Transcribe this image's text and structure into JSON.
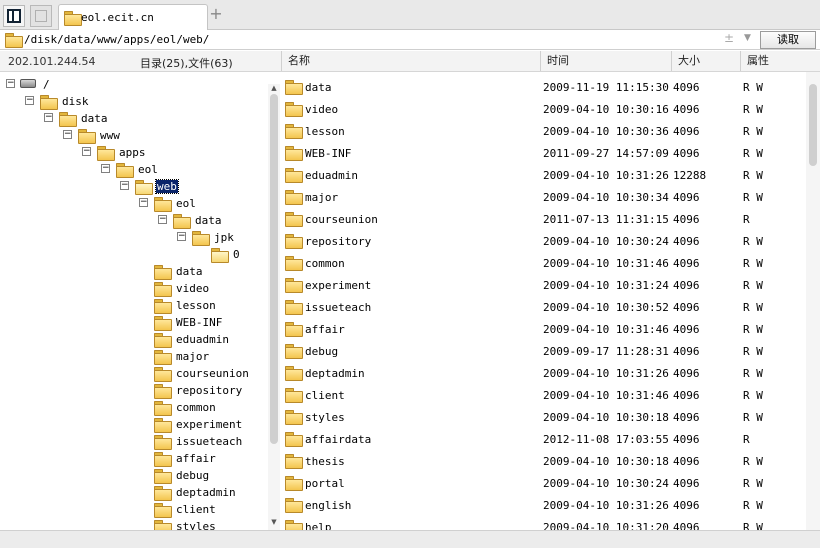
{
  "tabbar": {
    "active_tab_label": "eol.ecit.cn",
    "add_tab_glyph": "+"
  },
  "pathbar": {
    "path": "/disk/data/www/apps/eol/web/",
    "plus_minus_glyph": "±",
    "read_button_label": "读取"
  },
  "status": {
    "ip": "202.101.244.54",
    "counts": "目录(25),文件(63)"
  },
  "columns": {
    "name": "名称",
    "time": "时间",
    "size": "大小",
    "attr": "属性"
  },
  "tree": [
    {
      "label": "/",
      "depth": 0,
      "kind": "drive",
      "expander": "−"
    },
    {
      "label": "disk",
      "depth": 1,
      "kind": "folder",
      "expander": "−"
    },
    {
      "label": "data",
      "depth": 2,
      "kind": "folder",
      "expander": "−"
    },
    {
      "label": "www",
      "depth": 3,
      "kind": "folder",
      "expander": "−"
    },
    {
      "label": "apps",
      "depth": 4,
      "kind": "folder",
      "expander": "−"
    },
    {
      "label": "eol",
      "depth": 5,
      "kind": "folder",
      "expander": "−"
    },
    {
      "label": "web",
      "depth": 6,
      "kind": "open",
      "expander": "−",
      "selected": true
    },
    {
      "label": "eol",
      "depth": 7,
      "kind": "folder",
      "expander": "−"
    },
    {
      "label": "data",
      "depth": 8,
      "kind": "folder",
      "expander": "−"
    },
    {
      "label": "jpk",
      "depth": 9,
      "kind": "folder",
      "expander": "−"
    },
    {
      "label": "0",
      "depth": 10,
      "kind": "open",
      "expander": ""
    },
    {
      "label": "data",
      "depth": 7,
      "kind": "folder",
      "expander": ""
    },
    {
      "label": "video",
      "depth": 7,
      "kind": "folder",
      "expander": ""
    },
    {
      "label": "lesson",
      "depth": 7,
      "kind": "folder",
      "expander": ""
    },
    {
      "label": "WEB-INF",
      "depth": 7,
      "kind": "folder",
      "expander": ""
    },
    {
      "label": "eduadmin",
      "depth": 7,
      "kind": "folder",
      "expander": ""
    },
    {
      "label": "major",
      "depth": 7,
      "kind": "folder",
      "expander": ""
    },
    {
      "label": "courseunion",
      "depth": 7,
      "kind": "folder",
      "expander": ""
    },
    {
      "label": "repository",
      "depth": 7,
      "kind": "folder",
      "expander": ""
    },
    {
      "label": "common",
      "depth": 7,
      "kind": "folder",
      "expander": ""
    },
    {
      "label": "experiment",
      "depth": 7,
      "kind": "folder",
      "expander": ""
    },
    {
      "label": "issueteach",
      "depth": 7,
      "kind": "folder",
      "expander": ""
    },
    {
      "label": "affair",
      "depth": 7,
      "kind": "folder",
      "expander": ""
    },
    {
      "label": "debug",
      "depth": 7,
      "kind": "folder",
      "expander": ""
    },
    {
      "label": "deptadmin",
      "depth": 7,
      "kind": "folder",
      "expander": ""
    },
    {
      "label": "client",
      "depth": 7,
      "kind": "folder",
      "expander": ""
    },
    {
      "label": "styles",
      "depth": 7,
      "kind": "folder",
      "expander": ""
    }
  ],
  "files": [
    {
      "name": "data",
      "time": "2009-11-19 11:15:30",
      "size": "4096",
      "attr": "R W"
    },
    {
      "name": "video",
      "time": "2009-04-10 10:30:16",
      "size": "4096",
      "attr": "R W"
    },
    {
      "name": "lesson",
      "time": "2009-04-10 10:30:36",
      "size": "4096",
      "attr": "R W"
    },
    {
      "name": "WEB-INF",
      "time": "2011-09-27 14:57:09",
      "size": "4096",
      "attr": "R W"
    },
    {
      "name": "eduadmin",
      "time": "2009-04-10 10:31:26",
      "size": "12288",
      "attr": "R W"
    },
    {
      "name": "major",
      "time": "2009-04-10 10:30:34",
      "size": "4096",
      "attr": "R W"
    },
    {
      "name": "courseunion",
      "time": "2011-07-13 11:31:15",
      "size": "4096",
      "attr": "R"
    },
    {
      "name": "repository",
      "time": "2009-04-10 10:30:24",
      "size": "4096",
      "attr": "R W"
    },
    {
      "name": "common",
      "time": "2009-04-10 10:31:46",
      "size": "4096",
      "attr": "R W"
    },
    {
      "name": "experiment",
      "time": "2009-04-10 10:31:24",
      "size": "4096",
      "attr": "R W"
    },
    {
      "name": "issueteach",
      "time": "2009-04-10 10:30:52",
      "size": "4096",
      "attr": "R W"
    },
    {
      "name": "affair",
      "time": "2009-04-10 10:31:46",
      "size": "4096",
      "attr": "R W"
    },
    {
      "name": "debug",
      "time": "2009-09-17 11:28:31",
      "size": "4096",
      "attr": "R W"
    },
    {
      "name": "deptadmin",
      "time": "2009-04-10 10:31:26",
      "size": "4096",
      "attr": "R W"
    },
    {
      "name": "client",
      "time": "2009-04-10 10:31:46",
      "size": "4096",
      "attr": "R W"
    },
    {
      "name": "styles",
      "time": "2009-04-10 10:30:18",
      "size": "4096",
      "attr": "R W"
    },
    {
      "name": "affairdata",
      "time": "2012-11-08 17:03:55",
      "size": "4096",
      "attr": "R"
    },
    {
      "name": "thesis",
      "time": "2009-04-10 10:30:18",
      "size": "4096",
      "attr": "R W"
    },
    {
      "name": "portal",
      "time": "2009-04-10 10:30:24",
      "size": "4096",
      "attr": "R W"
    },
    {
      "name": "english",
      "time": "2009-04-10 10:31:26",
      "size": "4096",
      "attr": "R W"
    },
    {
      "name": "help",
      "time": "2009-04-10 10:31:20",
      "size": "4096",
      "attr": "R W"
    }
  ],
  "icons": {
    "panel_toggle": "panel-toggle-icon",
    "folder": "folder-icon",
    "drive": "drive-icon"
  }
}
